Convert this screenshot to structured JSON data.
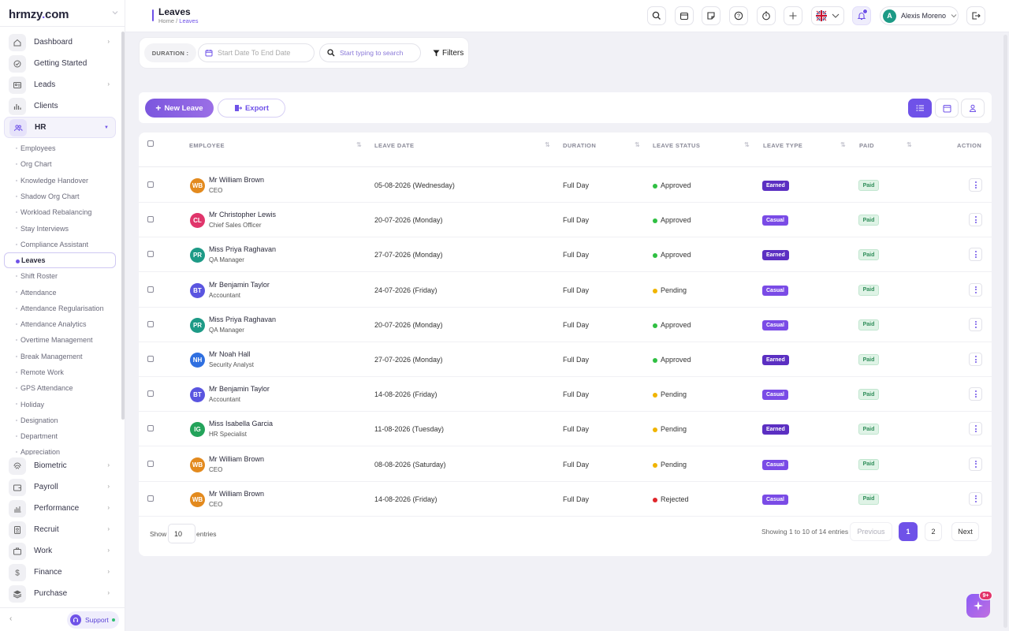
{
  "app": {
    "logo": "hrmzy.com",
    "logo_dot": "."
  },
  "sidebar": {
    "items_top": [
      {
        "label": "Dashboard",
        "icon": "home-icon",
        "arrow": true
      },
      {
        "label": "Getting Started",
        "icon": "check-circle-icon",
        "arrow": false
      },
      {
        "label": "Leads",
        "icon": "id-card-icon",
        "arrow": true
      },
      {
        "label": "Clients",
        "icon": "bar-chart-icon",
        "arrow": false
      },
      {
        "label": "HR",
        "icon": "users-icon",
        "arrow": true
      }
    ],
    "hr_sub": [
      "Employees",
      "Org Chart",
      "Knowledge Handover",
      "Shadow Org Chart",
      "Workload Rebalancing",
      "Stay Interviews",
      "Compliance Assistant",
      "Leaves",
      "Shift Roster",
      "Attendance",
      "Attendance Regularisation",
      "Attendance Analytics",
      "Overtime Management",
      "Break Management",
      "Remote Work",
      "GPS Attendance",
      "Holiday",
      "Designation",
      "Department",
      "Appreciation"
    ],
    "items_bottom": [
      {
        "label": "Biometric",
        "icon": "fingerprint-icon"
      },
      {
        "label": "Payroll",
        "icon": "wallet-icon"
      },
      {
        "label": "Performance",
        "icon": "chart-icon"
      },
      {
        "label": "Recruit",
        "icon": "badge-icon"
      },
      {
        "label": "Work",
        "icon": "briefcase-icon"
      },
      {
        "label": "Finance",
        "icon": "dollar-icon"
      },
      {
        "label": "Purchase",
        "icon": "stack-icon"
      }
    ],
    "support": "Support"
  },
  "header": {
    "title": "Leaves",
    "breadcrumb_home": "Home",
    "breadcrumb_sep": "/",
    "breadcrumb_current": "Leaves",
    "user": "Alexis Moreno",
    "user_initial": "A"
  },
  "filters": {
    "duration_label": "DURATION :",
    "date_placeholder": "Start Date To End Date",
    "search_placeholder": "Start typing to search",
    "filters_label": "Filters"
  },
  "actions": {
    "new_leave": "New Leave",
    "export": "Export"
  },
  "table": {
    "columns": [
      "EMPLOYEE",
      "LEAVE DATE",
      "DURATION",
      "LEAVE STATUS",
      "LEAVE TYPE",
      "PAID",
      "ACTION"
    ],
    "rows": [
      {
        "initials": "WB",
        "avatar_color": "#e38a1e",
        "name": "Mr William Brown",
        "role": "CEO",
        "date": "05-08-2026 (Wednesday)",
        "duration": "Full Day",
        "status": "Approved",
        "status_color": "#2fbf42",
        "type": "Earned",
        "type_color": "#5b2fc2",
        "paid": "Paid"
      },
      {
        "initials": "CL",
        "avatar_color": "#e0356b",
        "name": "Mr Christopher Lewis",
        "role": "Chief Sales Officer",
        "date": "20-07-2026 (Monday)",
        "duration": "Full Day",
        "status": "Approved",
        "status_color": "#2fbf42",
        "type": "Casual",
        "type_color": "#7a4be6",
        "paid": "Paid"
      },
      {
        "initials": "PR",
        "avatar_color": "#1d9a86",
        "name": "Miss Priya Raghavan",
        "role": "QA Manager",
        "date": "27-07-2026 (Monday)",
        "duration": "Full Day",
        "status": "Approved",
        "status_color": "#2fbf42",
        "type": "Earned",
        "type_color": "#5b2fc2",
        "paid": "Paid"
      },
      {
        "initials": "BT",
        "avatar_color": "#5a55e0",
        "name": "Mr Benjamin Taylor",
        "role": "Accountant",
        "date": "24-07-2026 (Friday)",
        "duration": "Full Day",
        "status": "Pending",
        "status_color": "#f0b400",
        "type": "Casual",
        "type_color": "#7a4be6",
        "paid": "Paid"
      },
      {
        "initials": "PR",
        "avatar_color": "#1d9a86",
        "name": "Miss Priya Raghavan",
        "role": "QA Manager",
        "date": "20-07-2026 (Monday)",
        "duration": "Full Day",
        "status": "Approved",
        "status_color": "#2fbf42",
        "type": "Casual",
        "type_color": "#7a4be6",
        "paid": "Paid"
      },
      {
        "initials": "NH",
        "avatar_color": "#2f6fe0",
        "name": "Mr Noah Hall",
        "role": "Security Analyst",
        "date": "27-07-2026 (Monday)",
        "duration": "Full Day",
        "status": "Approved",
        "status_color": "#2fbf42",
        "type": "Earned",
        "type_color": "#5b2fc2",
        "paid": "Paid"
      },
      {
        "initials": "BT",
        "avatar_color": "#5a55e0",
        "name": "Mr Benjamin Taylor",
        "role": "Accountant",
        "date": "14-08-2026 (Friday)",
        "duration": "Full Day",
        "status": "Pending",
        "status_color": "#f0b400",
        "type": "Casual",
        "type_color": "#7a4be6",
        "paid": "Paid"
      },
      {
        "initials": "IG",
        "avatar_color": "#23a35a",
        "name": "Miss Isabella Garcia",
        "role": "HR Specialist",
        "date": "11-08-2026 (Tuesday)",
        "duration": "Full Day",
        "status": "Pending",
        "status_color": "#f0b400",
        "type": "Earned",
        "type_color": "#5b2fc2",
        "paid": "Paid"
      },
      {
        "initials": "WB",
        "avatar_color": "#e38a1e",
        "name": "Mr William Brown",
        "role": "CEO",
        "date": "08-08-2026 (Saturday)",
        "duration": "Full Day",
        "status": "Pending",
        "status_color": "#f0b400",
        "type": "Casual",
        "type_color": "#7a4be6",
        "paid": "Paid"
      },
      {
        "initials": "WB",
        "avatar_color": "#e38a1e",
        "name": "Mr William Brown",
        "role": "CEO",
        "date": "14-08-2026 (Friday)",
        "duration": "Full Day",
        "status": "Rejected",
        "status_color": "#e0262b",
        "type": "Casual",
        "type_color": "#7a4be6",
        "paid": "Paid"
      }
    ],
    "show_label": "Show",
    "page_size": "10",
    "entries_label": "entries",
    "showing": "Showing 1 to 10 of 14 entries",
    "prev": "Previous",
    "pages": [
      "1",
      "2"
    ],
    "current_page": "1",
    "next": "Next"
  },
  "fab_badge": "9+",
  "colors": {
    "accent": "#6f52e8"
  }
}
